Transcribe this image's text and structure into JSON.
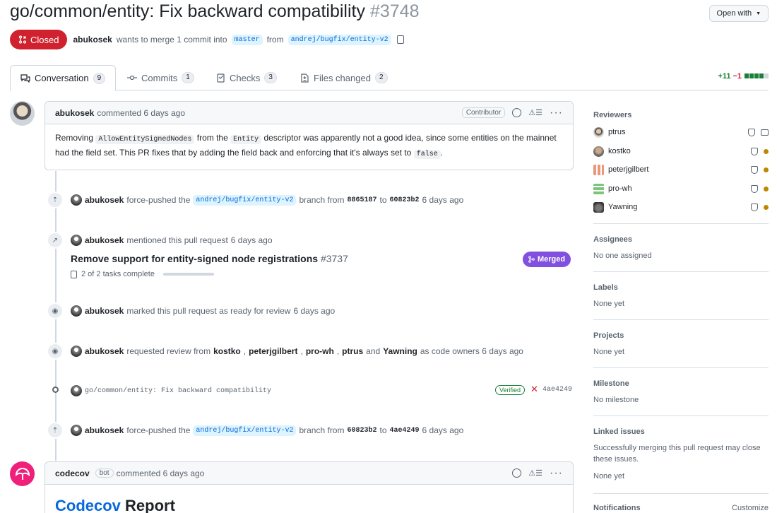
{
  "header": {
    "title": "go/common/entity: Fix backward compatibility",
    "number": "#3748",
    "open_with": "Open with",
    "state": "Closed",
    "author": "abukosek",
    "merge_text": "wants to merge 1 commit into",
    "base": "master",
    "from_text": "from",
    "head": "andrej/bugfix/entity-v2"
  },
  "tabs": [
    {
      "label": "Conversation",
      "count": "9"
    },
    {
      "label": "Commits",
      "count": "1"
    },
    {
      "label": "Checks",
      "count": "3"
    },
    {
      "label": "Files changed",
      "count": "2"
    }
  ],
  "diffstat": {
    "plus": "+11",
    "minus": "−1",
    "colors": [
      "#1a7f37",
      "#1a7f37",
      "#1a7f37",
      "#1a7f37",
      "#d0d7de"
    ]
  },
  "comment1": {
    "author": "abukosek",
    "when": "commented 6 days ago",
    "role": "Contributor",
    "t1": "Removing",
    "c1": "AllowEntitySignedNodes",
    "t2": "from the",
    "c2": "Entity",
    "t3": "descriptor was apparently not a good idea, since some entities on the mainnet had the field set. This PR fixes that by adding the field back and enforcing that it's always set to",
    "c3": "false",
    "t4": "."
  },
  "timeline": {
    "fp1": {
      "user": "abukosek",
      "a": "force-pushed the",
      "branch": "andrej/bugfix/entity-v2",
      "b": "branch from",
      "from": "8865187",
      "to_word": "to",
      "to": "60823b2",
      "when": "6 days ago"
    },
    "mention": {
      "user": "abukosek",
      "text": "mentioned this pull request",
      "when": "6 days ago"
    },
    "ref_title": "Remove support for entity-signed node registrations",
    "ref_num": "#3737",
    "ref_state": "Merged",
    "tasks": "2 of 2 tasks complete",
    "ready": {
      "user": "abukosek",
      "text": "marked this pull request as ready for review",
      "when": "6 days ago"
    },
    "review": {
      "user": "abukosek",
      "text": "requested review from",
      "r1": "kostko",
      "r2": "peterjgilbert",
      "r3": "pro-wh",
      "r4": "ptrus",
      "and": "and",
      "r5": "Yawning",
      "tail": "as code owners 6 days ago"
    },
    "commit": {
      "message": "go/common/entity: Fix backward compatibility",
      "verified": "Verified",
      "sha": "4ae4249"
    },
    "fp2": {
      "user": "abukosek",
      "a": "force-pushed the",
      "branch": "andrej/bugfix/entity-v2",
      "b": "branch from",
      "from": "60823b2",
      "to_word": "to",
      "to": "4ae4249",
      "when": "6 days ago"
    }
  },
  "comment2": {
    "author": "codecov",
    "bot": "bot",
    "when": "commented 6 days ago",
    "title_brand": "Codecov",
    "title_rest": "Report"
  },
  "sidebar": {
    "reviewers_h": "Reviewers",
    "reviewers": [
      "ptrus",
      "kostko",
      "peterjgilbert",
      "pro-wh",
      "Yawning"
    ],
    "assignees_h": "Assignees",
    "assignees_v": "No one assigned",
    "labels_h": "Labels",
    "labels_v": "None yet",
    "projects_h": "Projects",
    "projects_v": "None yet",
    "milestone_h": "Milestone",
    "milestone_v": "No milestone",
    "linked_h": "Linked issues",
    "linked_desc": "Successfully merging this pull request may close these issues.",
    "linked_v": "None yet",
    "notif_h": "Notifications",
    "customize": "Customize"
  }
}
